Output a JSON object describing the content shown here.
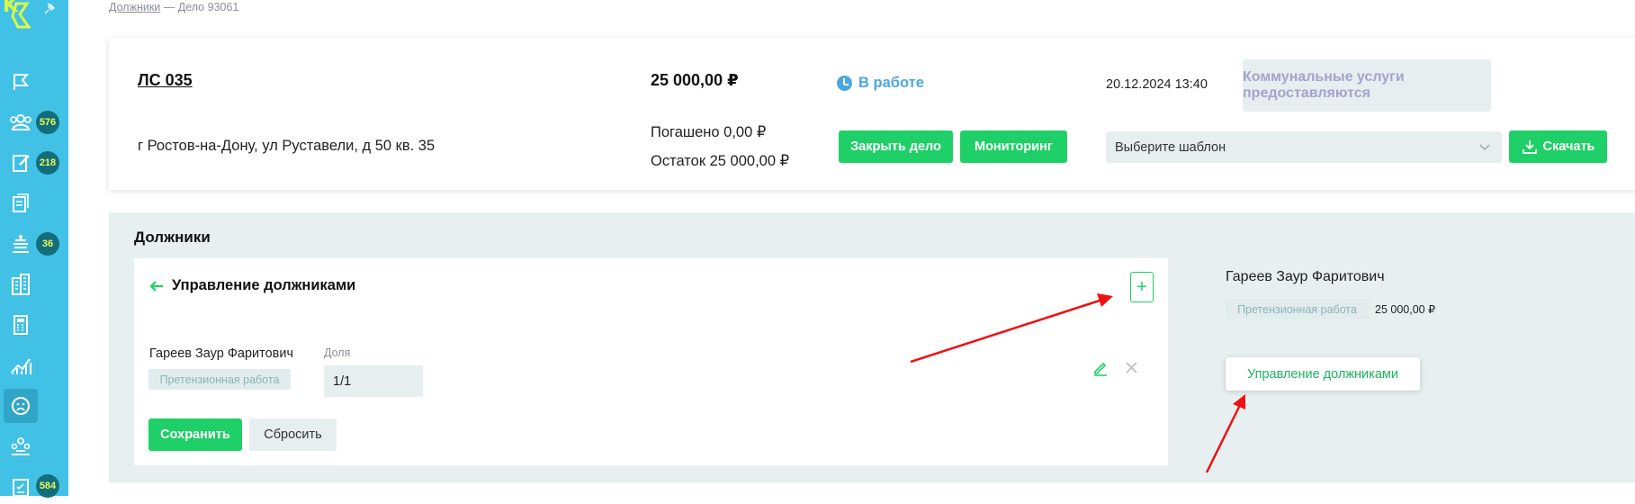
{
  "sidebar": {
    "logo_text": "K",
    "badges": {
      "debtors": "576",
      "tasks": "218",
      "court": "36",
      "checklist": "584"
    },
    "icons": [
      "flag-icon",
      "people-icon",
      "edit-doc-icon",
      "documents-icon",
      "court-icon",
      "building-icon",
      "calculator-icon",
      "chart-icon",
      "sad-face-icon",
      "group-icon",
      "checklist-icon"
    ]
  },
  "breadcrumb": {
    "link": "Должники",
    "separator": "—",
    "current": "Дело 93061"
  },
  "case": {
    "title": "ЛС 035",
    "address": "г Ростов-на-Дону, ул Руставели, д 50 кв. 35",
    "amount": "25 000,00 ₽",
    "paid": "Погашено 0,00 ₽",
    "rest": "Остаток 25 000,00 ₽",
    "status": "В работе",
    "datetime": "20.12.2024 13:40",
    "services_label": "Коммунальные услуги предоставляются",
    "close_label": "Закрыть дело",
    "monitoring_label": "Мониторинг",
    "template_placeholder": "Выберите шаблон",
    "download_label": "Скачать"
  },
  "debtors": {
    "section_title": "Должники",
    "manage_title": "Управление должниками",
    "add_label": "+",
    "row": {
      "name": "Гареев Заур Фаритович",
      "tag": "Претензионная работа",
      "share_label": "Доля",
      "share_value": "1/1"
    },
    "save_label": "Сохранить",
    "reset_label": "Сбросить",
    "side": {
      "name": "Гареев Заур Фаритович",
      "tag": "Претензионная работа",
      "amount": "25 000,00 ₽",
      "manage_label": "Управление должниками"
    }
  },
  "colors": {
    "accent": "#1fcf67",
    "sidebar": "#42c1e6",
    "status": "#4aa8e0",
    "annotation": "#ff0000"
  }
}
